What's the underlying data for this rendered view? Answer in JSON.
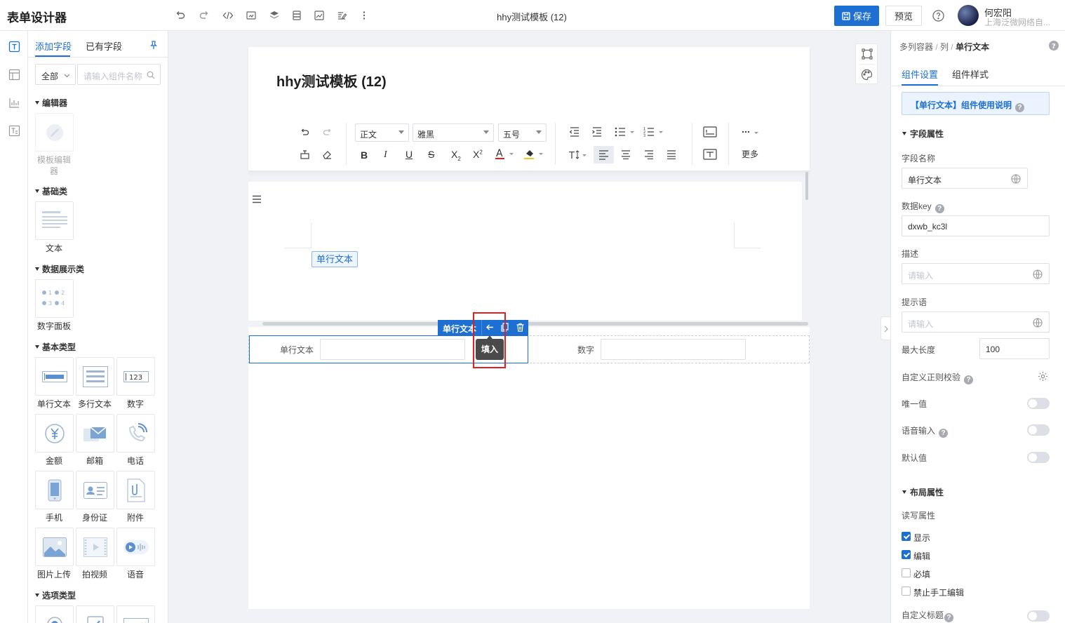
{
  "header": {
    "app_title": "表单设计器",
    "document_title": "hhy测试模板 (12)",
    "save_label": "保存",
    "preview_label": "预览",
    "user_name": "何宏阳",
    "user_org": "上海泛微网络自..."
  },
  "left_panel": {
    "tabs": [
      "添加字段",
      "已有字段"
    ],
    "filter_value": "全部",
    "search_placeholder": "请输入组件名称",
    "categories": {
      "editor": "编辑器",
      "basic": "基础类",
      "data_display": "数据展示类",
      "basic_types": "基本类型",
      "option_types": "选项类型"
    },
    "items": {
      "template_editor": "模板编辑器",
      "text": "文本",
      "number_panel": "数字面板",
      "single_line": "单行文本",
      "multi_line": "多行文本",
      "number": "数字",
      "amount": "金额",
      "email": "邮箱",
      "phone": "电话",
      "mobile": "手机",
      "id_card": "身份证",
      "attachment": "附件",
      "image_upload": "图片上传",
      "video": "拍视频",
      "voice": "语音"
    }
  },
  "canvas": {
    "form_title": "hhy测试模板 (12)",
    "rich_toolbar": {
      "paragraph": "正文",
      "font": "雅黑",
      "font_size": "五号",
      "more_label": "更多"
    },
    "text_tag": "单行文本",
    "field_single_label": "单行文本",
    "field_number_label": "数字",
    "component_toolbar_label": "单行文本",
    "tooltip": "填入"
  },
  "right_panel": {
    "breadcrumb": [
      "多列容器",
      "列",
      "单行文本"
    ],
    "tabs": [
      "组件设置",
      "组件样式"
    ],
    "usage_banner": "【单行文本】组件使用说明",
    "section_field": "字段属性",
    "field_name_label": "字段名称",
    "field_name_value": "单行文本",
    "data_key_label": "数据key",
    "data_key_value": "dxwb_kc3l",
    "desc_label": "描述",
    "desc_placeholder": "请输入",
    "hint_label": "提示语",
    "hint_placeholder": "请输入",
    "max_length_label": "最大长度",
    "max_length_value": "100",
    "regex_label": "自定义正则校验",
    "unique_label": "唯一值",
    "voice_label": "语音输入",
    "default_label": "默认值",
    "section_layout": "布局属性",
    "rw_label": "读写属性",
    "checkboxes": [
      {
        "label": "显示",
        "checked": true
      },
      {
        "label": "编辑",
        "checked": true
      },
      {
        "label": "必填",
        "checked": false
      },
      {
        "label": "禁止手工编辑",
        "checked": false
      }
    ],
    "custom_title_label": "自定义标题"
  },
  "colors": {
    "accent": "#1d6fd1",
    "highlight_box": "#e02020",
    "tooltip_bg": "#4a4a4a"
  }
}
